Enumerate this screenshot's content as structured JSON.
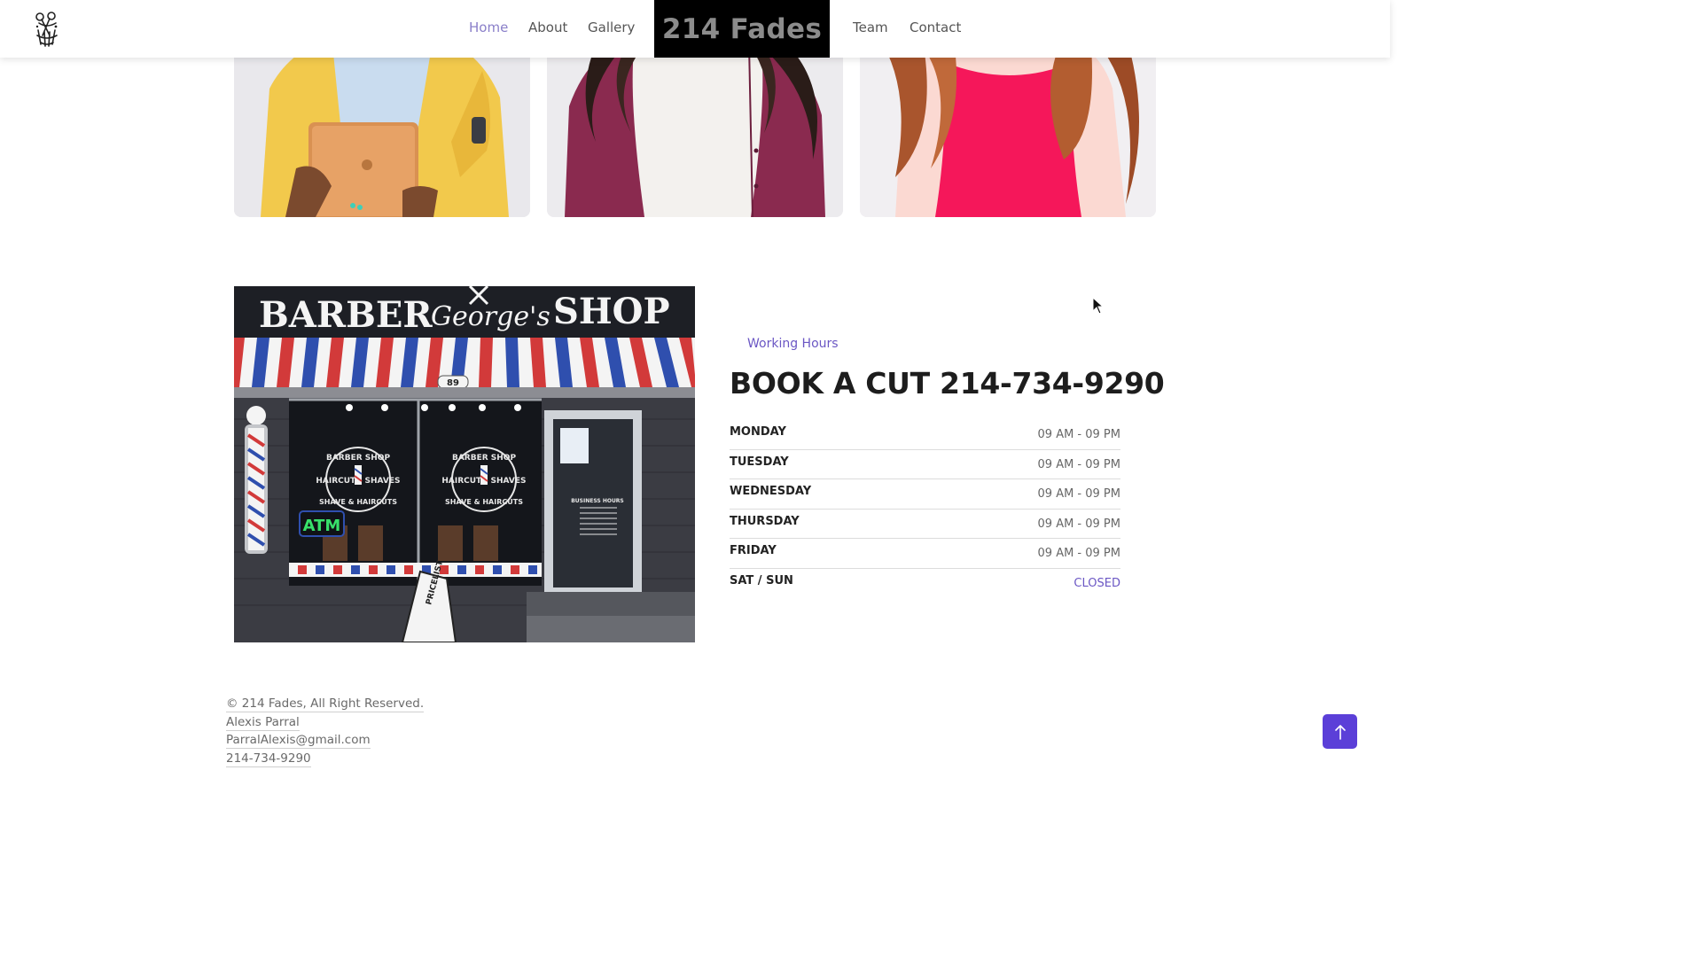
{
  "header": {
    "brand": "214 Fades",
    "nav": {
      "home": "Home",
      "about": "About",
      "gallery": "Gallery",
      "team": "Team",
      "contact": "Contact"
    }
  },
  "hours": {
    "eyebrow": "Working Hours",
    "title": "BOOK A CUT 214-734-9290",
    "rows": [
      {
        "day": "MONDAY",
        "time": "09 AM - 09 PM"
      },
      {
        "day": "TUESDAY",
        "time": "09 AM - 09 PM"
      },
      {
        "day": "WEDNESDAY",
        "time": "09 AM - 09 PM"
      },
      {
        "day": "THURSDAY",
        "time": "09 AM - 09 PM"
      },
      {
        "day": "FRIDAY",
        "time": "09 AM - 09 PM"
      },
      {
        "day": "SAT / SUN",
        "time": "CLOSED"
      }
    ]
  },
  "shop_photo": {
    "sign_left": "BARBER",
    "sign_script": "George's",
    "sign_right": "SHOP",
    "awning_number": "89",
    "window_decal_top": "BARBER SHOP",
    "window_decal_left": "HAIRCUTS",
    "window_decal_right": "& SHAVES",
    "window_decal_bottom": "SHAVE & HAIRCUTS",
    "neon_sign": "ATM",
    "door_sign": "BUSINESS HOURS",
    "sandwich_board": "PRICELIST"
  },
  "footer": {
    "copyright": "© 214 Fades, All Right Reserved.",
    "name": "Alexis Parral",
    "email": "ParralAlexis@gmail.com",
    "phone": "214-734-9290"
  },
  "colors": {
    "accent": "#6b57c4",
    "nav_active": "#8a7fc9",
    "back_to_top": "#5b3fd8",
    "brand_bg": "#000000"
  },
  "icons": {
    "logo": "barber-logo-icon",
    "back_to_top": "arrow-up-icon",
    "cursor": "mouse-cursor-icon"
  }
}
